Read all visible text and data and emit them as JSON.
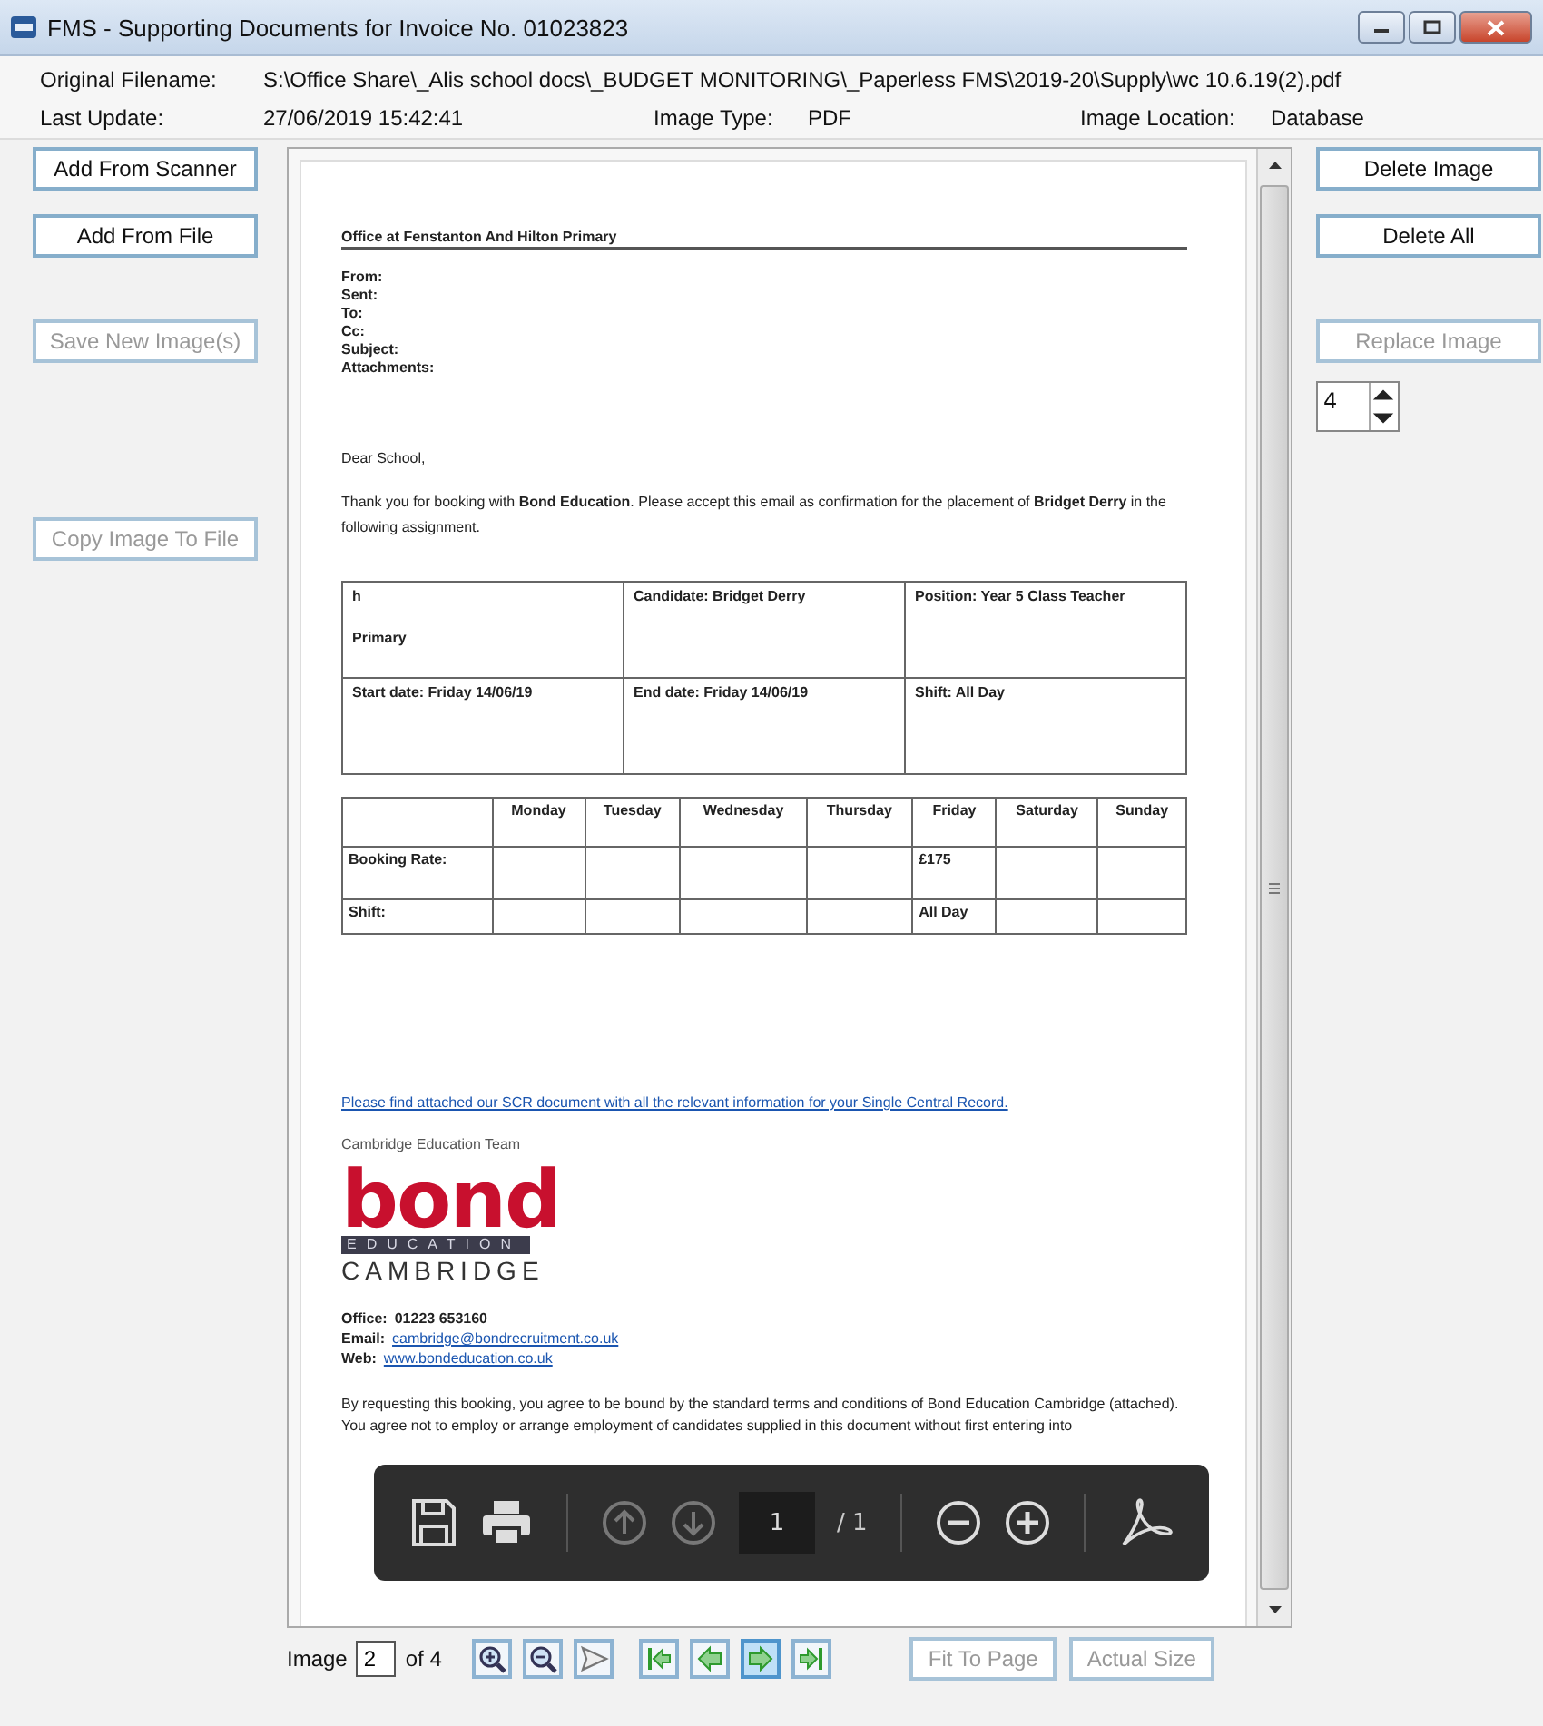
{
  "window": {
    "title": "FMS - Supporting Documents for Invoice No. 01023823"
  },
  "info": {
    "original_filename_label": "Original Filename:",
    "original_filename": "S:\\Office Share\\_Alis school docs\\_BUDGET MONITORING\\_Paperless FMS\\2019-20\\Supply\\wc 10.6.19(2).pdf",
    "last_update_label": "Last Update:",
    "last_update": "27/06/2019 15:42:41",
    "image_type_label": "Image Type:",
    "image_type": "PDF",
    "image_location_label": "Image Location:",
    "image_location": "Database"
  },
  "left_buttons": [
    {
      "label": "Add From Scanner",
      "disabled": false
    },
    {
      "label": "Add From File",
      "disabled": false
    },
    {
      "label": "Save New Image(s)",
      "disabled": true
    },
    {
      "label": "Copy Image To File",
      "disabled": true
    }
  ],
  "right_buttons": [
    {
      "label": "Delete Image",
      "disabled": false
    },
    {
      "label": "Delete All",
      "disabled": false
    },
    {
      "label": "Replace Image",
      "disabled": true
    }
  ],
  "image_spinner": {
    "value": "4"
  },
  "document": {
    "header": "Office at Fenstanton And Hilton Primary",
    "fields": [
      "From:",
      "Sent:",
      "To:",
      "Cc:",
      "Subject:",
      "Attachments:"
    ],
    "greeting": "Dear School,",
    "intro": "Thank you for booking with **Bond Education**. Please accept this email as confirmation for the placement of **Bridget Derry** in the following assignment.",
    "assignment_rows": [
      [
        [
          "h",
          "Primary"
        ],
        [
          "Candidate: Bridget Derry"
        ],
        [
          "Position: Year 5 Class Teacher"
        ]
      ],
      [
        [
          "Start date: Friday 14/06/19"
        ],
        [
          "End date: Friday 14/06/19"
        ],
        [
          "Shift: All Day"
        ]
      ]
    ],
    "schedule": {
      "columns": [
        "Monday",
        "Tuesday",
        "Wednesday",
        "Thursday",
        "Friday",
        "Saturday",
        "Sunday"
      ],
      "rows": [
        {
          "label": "Booking Rate:",
          "friday": "£175"
        },
        {
          "label": "Shift:",
          "friday": "All Day"
        }
      ]
    },
    "link": "Please find attached our SCR document with all the relevant information for your Single Central Record.",
    "signoff": "Cambridge Education Team",
    "logo": {
      "word": "bond",
      "band": "EDUCATION",
      "city": "CAMBRIDGE"
    },
    "contact": [
      {
        "label": "Office:",
        "value": "01223 653160",
        "kind": "text"
      },
      {
        "label": "Email:",
        "value": "cambridge@bondrecruitment.co.uk",
        "kind": "link"
      },
      {
        "label": "Web:",
        "value": "www.bondeducation.co.uk",
        "kind": "link"
      }
    ],
    "disclaimer": "By requesting this booking, you agree to be bound by the standard terms and conditions of Bond Education Cambridge (attached). You agree not to employ or arrange employment of candidates supplied in this document without first entering into"
  },
  "pdf_toolbar": {
    "page": "1",
    "total": "/ 1"
  },
  "footer": {
    "image_label": "Image",
    "image_value": "2",
    "of_label": "of 4",
    "nav": [
      {
        "kind": "zoom-in",
        "selected": false
      },
      {
        "kind": "zoom-out",
        "selected": false
      },
      {
        "kind": "send",
        "selected": false
      },
      {
        "kind": "first",
        "selected": false
      },
      {
        "kind": "previous",
        "selected": false
      },
      {
        "kind": "next",
        "selected": true
      },
      {
        "kind": "last",
        "selected": false
      }
    ],
    "buttons": [
      {
        "label": "Fit To Page",
        "disabled": true
      },
      {
        "label": "Actual Size",
        "disabled": true
      }
    ]
  }
}
